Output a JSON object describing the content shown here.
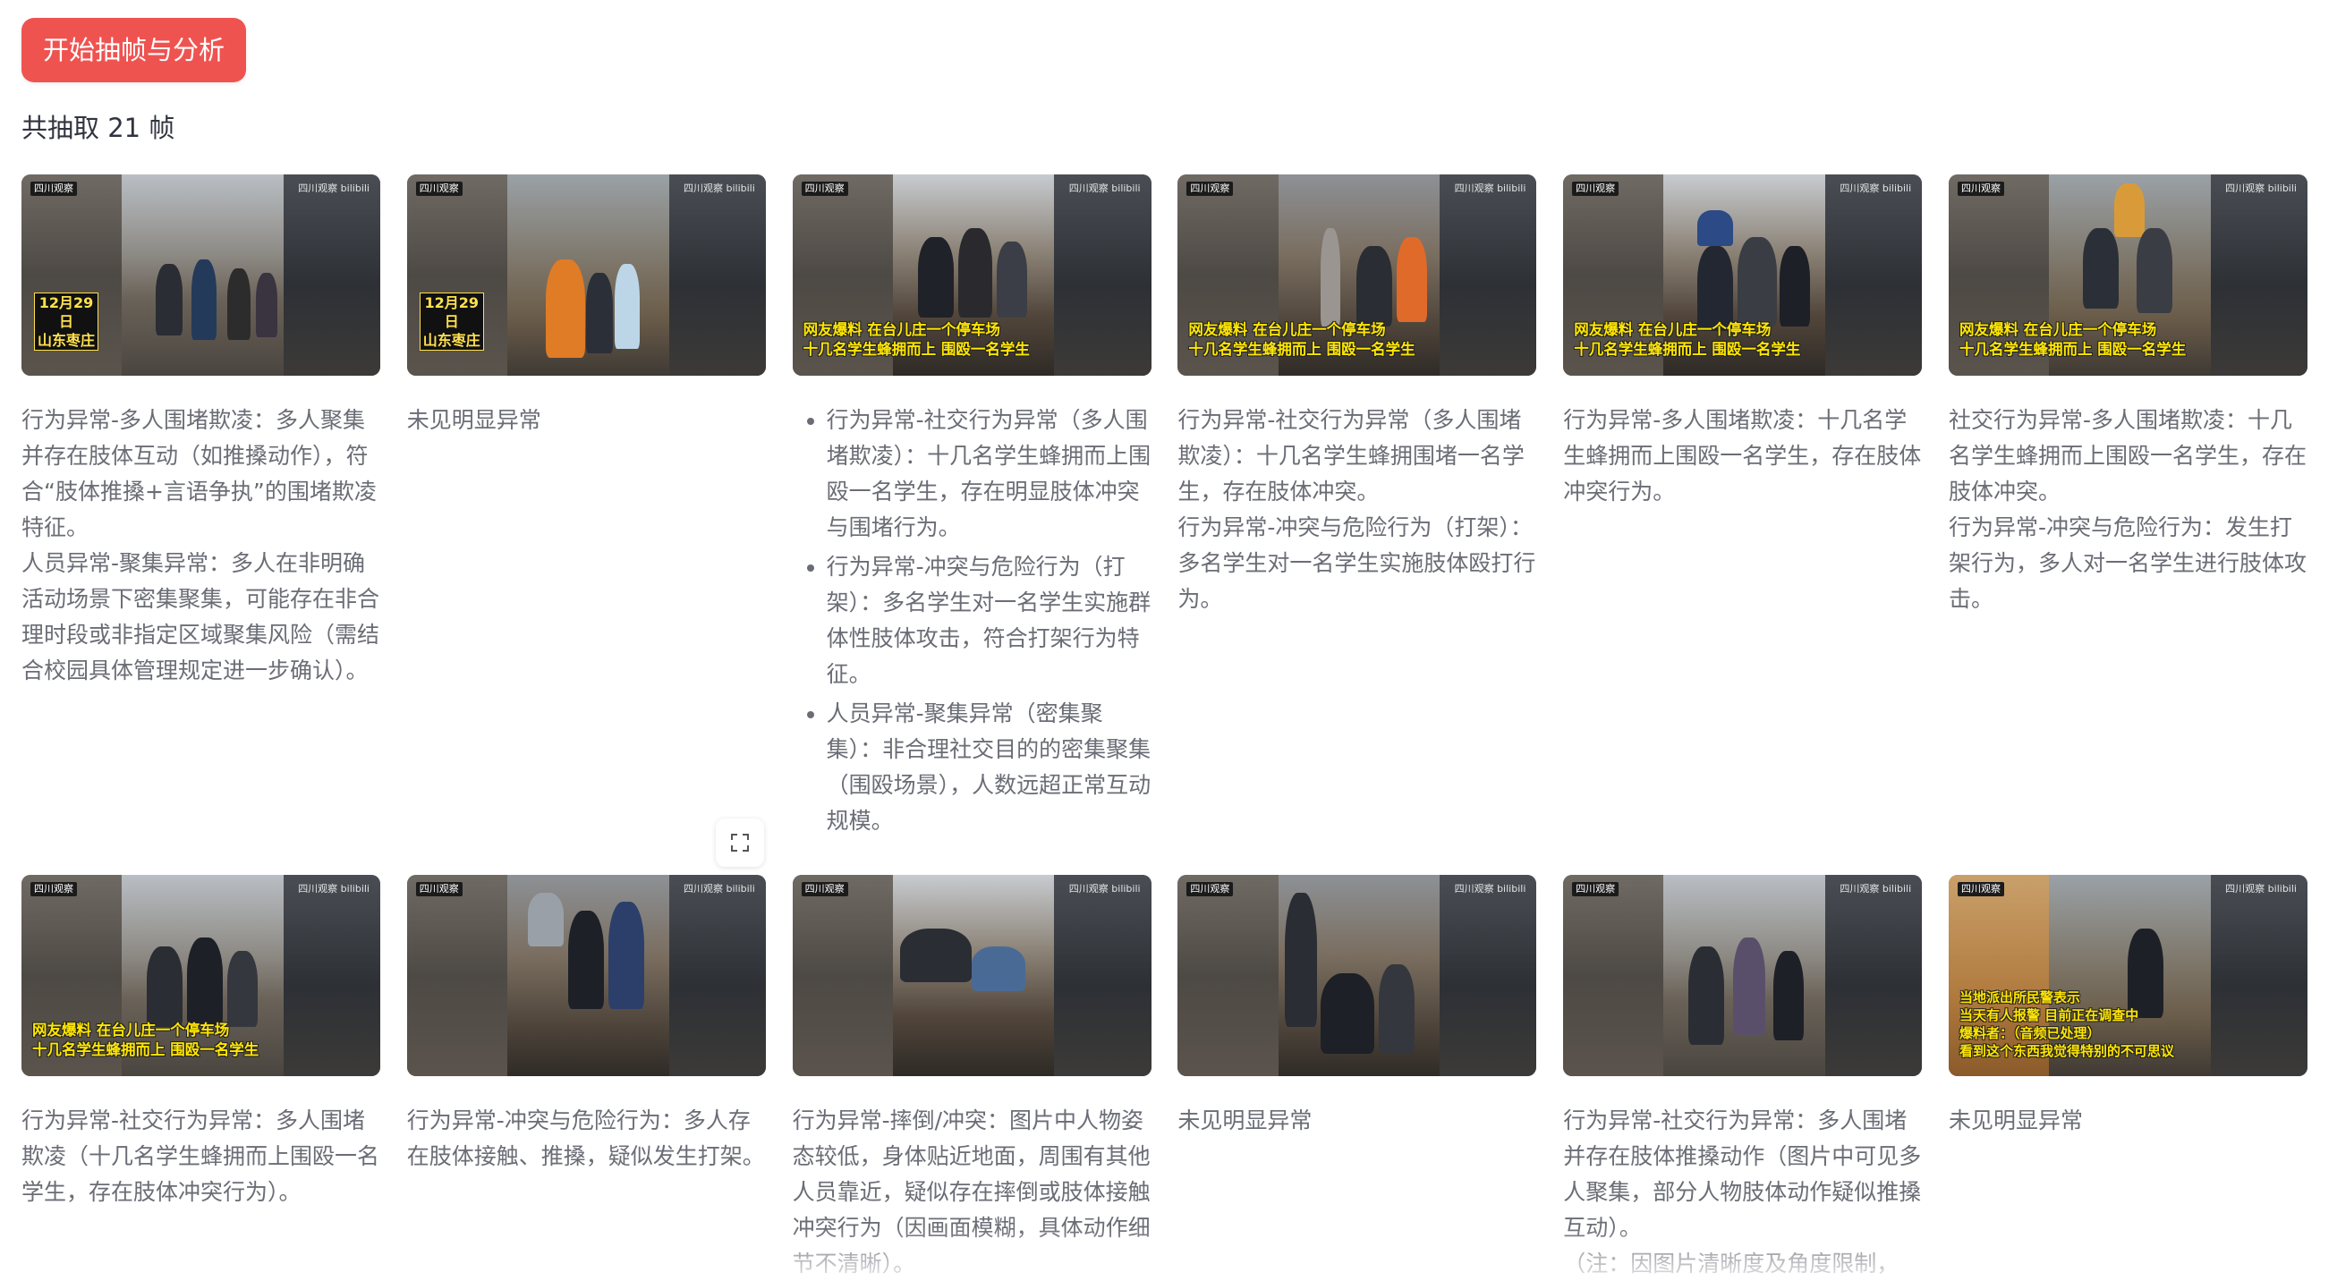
{
  "start_button_label": "开始抽帧与分析",
  "frame_count_text": "共抽取 21 帧",
  "thumb_common": {
    "logo": "四川观察",
    "watermark": "四川观察  bilibili"
  },
  "colors": {
    "button": "#ef5350",
    "caption": "#ffe600",
    "text_muted": "#6b6d76"
  },
  "frames_row1": [
    {
      "date_tag": "12月29日\n山东枣庄",
      "caption": "",
      "desc_paragraphs": [
        "行为异常-多人围堵欺凌：多人聚集并存在肢体互动（如推搡动作），符合“肢体推搡+言语争执”的围堵欺凌特征。",
        "人员异常-聚集异常：多人在非明确活动场景下密集聚集，可能存在非合理时段或非指定区域聚集风险（需结合校园具体管理规定进一步确认）。"
      ]
    },
    {
      "date_tag": "12月29日\n山东枣庄",
      "caption": "",
      "desc_paragraphs": [
        "未见明显异常"
      ]
    },
    {
      "date_tag": "",
      "caption": "网友爆料 在台儿庄一个停车场\n十几名学生蜂拥而上 围殴一名学生",
      "desc_list": [
        "行为异常-社交行为异常（多人围堵欺凌）：十几名学生蜂拥而上围殴一名学生，存在明显肢体冲突与围堵行为。",
        "行为异常-冲突与危险行为（打架）：多名学生对一名学生实施群体性肢体攻击，符合打架行为特征。",
        "人员异常-聚集异常（密集聚集）：非合理社交目的的密集聚集（围殴场景），人数远超正常互动规模。"
      ]
    },
    {
      "date_tag": "",
      "caption": "网友爆料 在台儿庄一个停车场\n十几名学生蜂拥而上 围殴一名学生",
      "desc_paragraphs": [
        "行为异常-社交行为异常（多人围堵欺凌）：十几名学生蜂拥围堵一名学生，存在肢体冲突。",
        "行为异常-冲突与危险行为（打架）：多名学生对一名学生实施肢体殴打行为。"
      ]
    },
    {
      "date_tag": "",
      "caption": "网友爆料 在台儿庄一个停车场\n十几名学生蜂拥而上 围殴一名学生",
      "desc_paragraphs": [
        "行为异常-多人围堵欺凌：十几名学生蜂拥而上围殴一名学生，存在肢体冲突行为。"
      ]
    },
    {
      "date_tag": "",
      "caption": "网友爆料 在台儿庄一个停车场\n十几名学生蜂拥而上 围殴一名学生",
      "desc_paragraphs": [
        "社交行为异常-多人围堵欺凌：十几名学生蜂拥而上围殴一名学生，存在肢体冲突。",
        "行为异常-冲突与危险行为：发生打架行为，多人对一名学生进行肢体攻击。"
      ]
    }
  ],
  "frames_row2": [
    {
      "caption": "网友爆料 在台儿庄一个停车场\n十几名学生蜂拥而上 围殴一名学生",
      "desc_paragraphs": [
        "行为异常-社交行为异常：多人围堵欺凌（十几名学生蜂拥而上围殴一名学生，存在肢体冲突行为）。"
      ]
    },
    {
      "caption": "",
      "desc_paragraphs": [
        "行为异常-冲突与危险行为：多人存在肢体接触、推搡，疑似发生打架。"
      ]
    },
    {
      "caption": "",
      "desc_paragraphs": [
        "行为异常-摔倒/冲突：图片中人物姿态较低，身体贴近地面，周围有其他人员靠近，疑似存在摔倒或肢体接触冲突行为（因画面模糊，具体动作细节不清晰）。"
      ]
    },
    {
      "caption": "",
      "desc_paragraphs": [
        "未见明显异常"
      ]
    },
    {
      "caption": "",
      "desc_paragraphs": [
        "行为异常-社交行为异常：多人围堵并存在肢体推搡动作（图片中可见多人聚集，部分人物肢体动作疑似推搡互动）。",
        "（注：因图片清晰度及角度限制，"
      ]
    },
    {
      "caption": "当地派出所民警表示\n当天有人报警 目前正在调查中\n爆料者：（音频已处理）\n看到这个东西我觉得特别的不可思议",
      "desc_paragraphs": [
        "未见明显异常"
      ]
    }
  ]
}
